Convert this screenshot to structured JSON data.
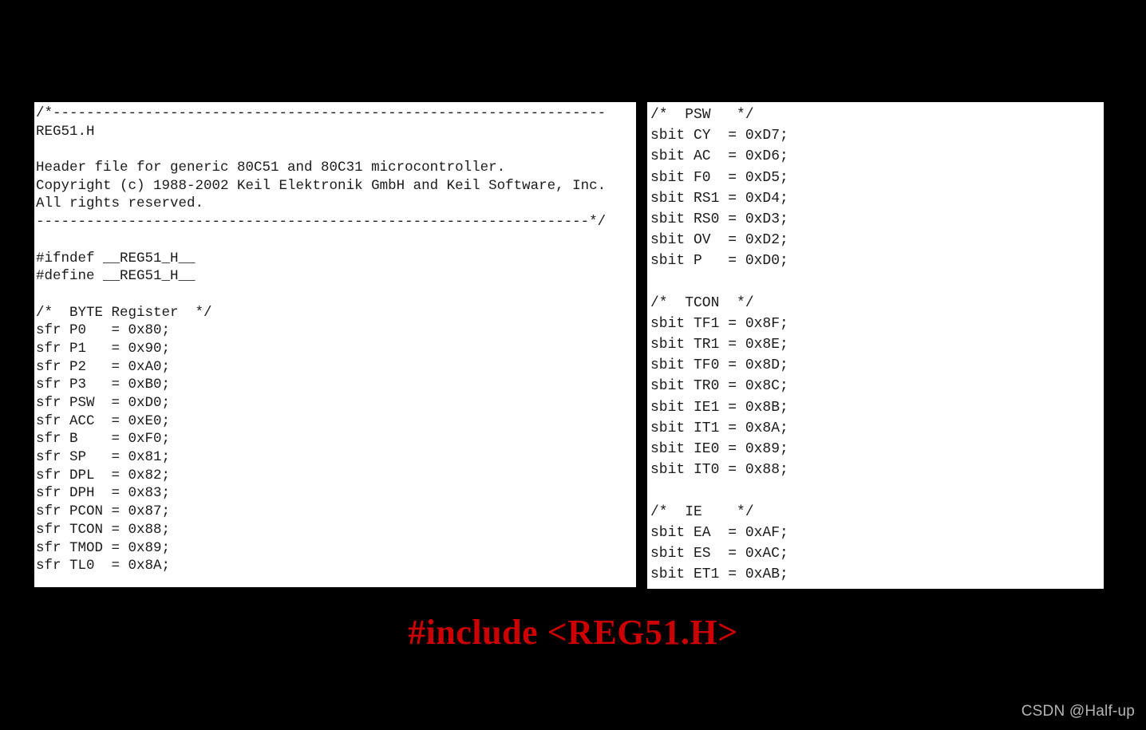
{
  "background_color": "#000000",
  "panel_background": "#ffffff",
  "caption": {
    "text": "#include <REG51.H>",
    "color": "#cc0000"
  },
  "watermark": {
    "text": "CSDN @Half-up",
    "color": "#b5b5b5"
  },
  "left_panel": {
    "name": "REG51.H header comment and BYTE register declarations",
    "text_color": "#1b1b1b",
    "lines": [
      "/*------------------------------------------------------------------",
      "REG51.H",
      "",
      "Header file for generic 80C51 and 80C31 microcontroller.",
      "Copyright (c) 1988-2002 Keil Elektronik GmbH and Keil Software, Inc.",
      "All rights reserved.",
      "------------------------------------------------------------------*/",
      "",
      "#ifndef __REG51_H__",
      "#define __REG51_H__",
      "",
      "/*  BYTE Register  */",
      "sfr P0   = 0x80;",
      "sfr P1   = 0x90;",
      "sfr P2   = 0xA0;",
      "sfr P3   = 0xB0;",
      "sfr PSW  = 0xD0;",
      "sfr ACC  = 0xE0;",
      "sfr B    = 0xF0;",
      "sfr SP   = 0x81;",
      "sfr DPL  = 0x82;",
      "sfr DPH  = 0x83;",
      "sfr PCON = 0x87;",
      "sfr TCON = 0x88;",
      "sfr TMOD = 0x89;",
      "sfr TL0  = 0x8A;"
    ]
  },
  "right_panel": {
    "name": "PSW, TCON and IE bit declarations",
    "text_color": "#1b1b1b",
    "lines": [
      "/*  PSW   */",
      "sbit CY  = 0xD7;",
      "sbit AC  = 0xD6;",
      "sbit F0  = 0xD5;",
      "sbit RS1 = 0xD4;",
      "sbit RS0 = 0xD3;",
      "sbit OV  = 0xD2;",
      "sbit P   = 0xD0;",
      "",
      "/*  TCON  */",
      "sbit TF1 = 0x8F;",
      "sbit TR1 = 0x8E;",
      "sbit TF0 = 0x8D;",
      "sbit TR0 = 0x8C;",
      "sbit IE1 = 0x8B;",
      "sbit IT1 = 0x8A;",
      "sbit IE0 = 0x89;",
      "sbit IT0 = 0x88;",
      "",
      "/*  IE    */",
      "sbit EA  = 0xAF;",
      "sbit ES  = 0xAC;",
      "sbit ET1 = 0xAB;"
    ]
  }
}
